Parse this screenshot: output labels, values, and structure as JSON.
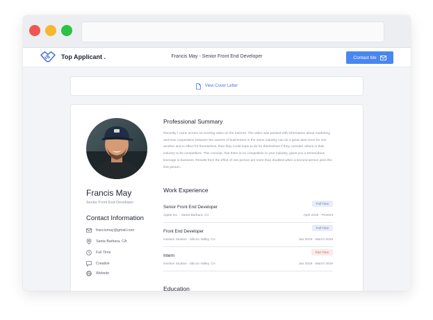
{
  "brand": {
    "name": "Top Applicant ."
  },
  "header": {
    "title": "Francis May - Senior Front End Developer",
    "contact_label": "Contact Me"
  },
  "cover": {
    "label": "View Cover Letter"
  },
  "profile": {
    "name": "Francis May",
    "role": "Senior Front End Developer",
    "contact_heading": "Contact Information",
    "contacts": [
      {
        "icon": "mail-icon",
        "text": "francismay@gmail.com"
      },
      {
        "icon": "location-pin-icon",
        "text": "Santa Barbara, CA"
      },
      {
        "icon": "clock-icon",
        "text": "Full Time"
      },
      {
        "icon": "chat-bubble-icon",
        "text": "Creative"
      },
      {
        "icon": "globe-icon",
        "text": "Website"
      }
    ]
  },
  "summary": {
    "heading": "Professional Summary",
    "text": "Recently I came across an exciting video on the internet. The video was packed with information about marketing and how cooperation between the owners of businesses in the same industry can do a great deal more for one another and in effect for themselves, than they could hope to do for themselves if they consider others in their industry to be competitors. This concept, that there is no competition in your industry, gives you a tremendous leverage in business. Results from the effort of one person are more than doubled when a second person joins the first person."
  },
  "experience": {
    "heading": "Work Experience",
    "jobs": [
      {
        "title": "Senior Front End Developer",
        "company": "Apple Inc. - Santa Barbara, CA",
        "dates": "April 2019 - Present",
        "badge": "Full Time",
        "badge_type": "full"
      },
      {
        "title": "Front End Developer",
        "company": "Invision Studios - Silicon Valley, CA",
        "dates": "Jan 2019 - March 2019",
        "badge": "Full Time",
        "badge_type": "full"
      },
      {
        "title": "Intern",
        "company": "Invision Studios - Silicon Valley, CA",
        "dates": "Jan 2019 - March 2019",
        "badge": "Part Time",
        "badge_type": "part"
      }
    ]
  },
  "education": {
    "heading": "Education"
  },
  "colors": {
    "accent": "#4a86f0",
    "link": "#4a74e8",
    "part_time": "#c06a6a"
  }
}
